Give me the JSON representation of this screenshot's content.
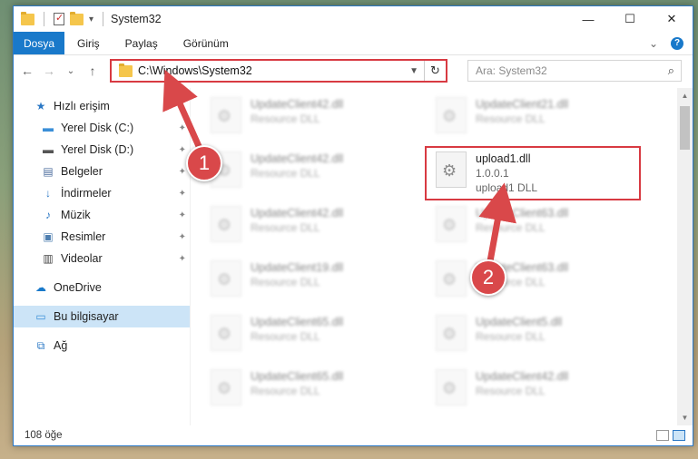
{
  "titlebar": {
    "title": "System32",
    "minimize": "—",
    "maximize": "☐",
    "close": "✕"
  },
  "ribbon": {
    "tabs": [
      "Dosya",
      "Giriş",
      "Paylaş",
      "Görünüm"
    ],
    "expand": "⌄",
    "help": "?"
  },
  "navbar": {
    "back": "←",
    "forward": "→",
    "recent": "⌄",
    "up": "↑",
    "address": "C:\\Windows\\System32",
    "refresh": "↻",
    "search_placeholder": "Ara: System32",
    "search_icon": "⌕"
  },
  "sidebar": {
    "items": [
      {
        "label": "Hızlı erişim",
        "icon": "star-icon",
        "glyph": "★",
        "color": "#2b78c5"
      },
      {
        "label": "Yerel Disk (C:)",
        "icon": "drive-icon",
        "glyph": "▬",
        "color": "#3a8fd8"
      },
      {
        "label": "Yerel Disk (D:)",
        "icon": "drive-icon",
        "glyph": "▬",
        "color": "#555555"
      },
      {
        "label": "Belgeler",
        "icon": "documents-icon",
        "glyph": "▤",
        "color": "#4f6f9f"
      },
      {
        "label": "İndirmeler",
        "icon": "downloads-icon",
        "glyph": "↓",
        "color": "#2b78c5"
      },
      {
        "label": "Müzik",
        "icon": "music-icon",
        "glyph": "♪",
        "color": "#2b78c5"
      },
      {
        "label": "Resimler",
        "icon": "pictures-icon",
        "glyph": "▣",
        "color": "#4f7fb0"
      },
      {
        "label": "Videolar",
        "icon": "videos-icon",
        "glyph": "▥",
        "color": "#444444"
      },
      {
        "label": "OneDrive",
        "icon": "cloud-icon",
        "glyph": "☁",
        "color": "#1979ca"
      },
      {
        "label": "Bu bilgisayar",
        "icon": "computer-icon",
        "glyph": "▭",
        "color": "#3a8fd8"
      },
      {
        "label": "Ağ",
        "icon": "network-icon",
        "glyph": "⧉",
        "color": "#2b78c5"
      }
    ],
    "pin": "📌"
  },
  "files": [
    {
      "name": "UpdateClient42.dll",
      "sub": "Resource DLL"
    },
    {
      "name": "UpdateClient21.dll",
      "sub": "Resource DLL"
    },
    {
      "name": "UpdateClient42.dll",
      "sub": "Resource DLL"
    },
    {
      "name": "upload1.dll",
      "version": "1.0.0.1",
      "sub": "upload1 DLL"
    },
    {
      "name": "UpdateClient42.dll",
      "sub": "Resource DLL"
    },
    {
      "name": "UpdateClient63.dll",
      "sub": "Resource DLL"
    },
    {
      "name": "UpdateClient19.dll",
      "sub": "Resource DLL"
    },
    {
      "name": "UpdateClient63.dll",
      "sub": "Resource DLL"
    },
    {
      "name": "UpdateClient65.dll",
      "sub": "Resource DLL"
    },
    {
      "name": "UpdateClient5.dll",
      "sub": "Resource DLL"
    },
    {
      "name": "UpdateClient65.dll",
      "sub": "Resource DLL"
    },
    {
      "name": "UpdateClient42.dll",
      "sub": "Resource DLL"
    }
  ],
  "status": {
    "count": "108 öğe"
  },
  "annotations": {
    "step1": "1",
    "step2": "2",
    "color": "#d9484a"
  }
}
